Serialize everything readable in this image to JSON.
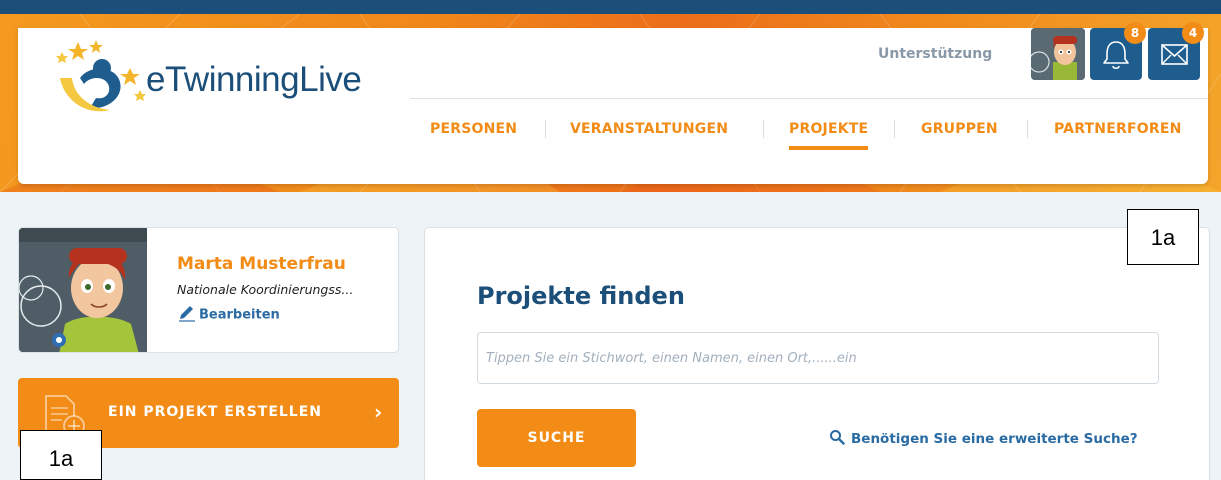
{
  "brand": {
    "logo_text": "eTwinningLive",
    "accent": "#f28c16",
    "primary": "#1b4e78"
  },
  "header": {
    "support_label": "Unterstützung",
    "notifications": {
      "icon": "bell-icon",
      "count": "8"
    },
    "messages": {
      "icon": "envelope-icon",
      "count": "4"
    }
  },
  "nav": {
    "items": [
      {
        "label": "PERSONEN"
      },
      {
        "label": "VERANSTALTUNGEN"
      },
      {
        "label": "PROJEKTE",
        "active": true
      },
      {
        "label": "GRUPPEN"
      },
      {
        "label": "PARTNERFOREN"
      }
    ]
  },
  "profile": {
    "name": "Marta Musterfrau",
    "role": "Nationale Koordinierungss...",
    "edit_label": "Bearbeiten"
  },
  "create_project": {
    "label": "EIN PROJEKT ERSTELLEN",
    "chevron": "›"
  },
  "search": {
    "title": "Projekte finden",
    "placeholder": "Tippen Sie ein Stichwort, einen Namen, einen Ort,......ein",
    "button_label": "SUCHE",
    "advanced_label": "Benötigen Sie eine erweiterte Suche?"
  },
  "annotations": {
    "top_right": "1a",
    "bottom_left": "1a"
  }
}
